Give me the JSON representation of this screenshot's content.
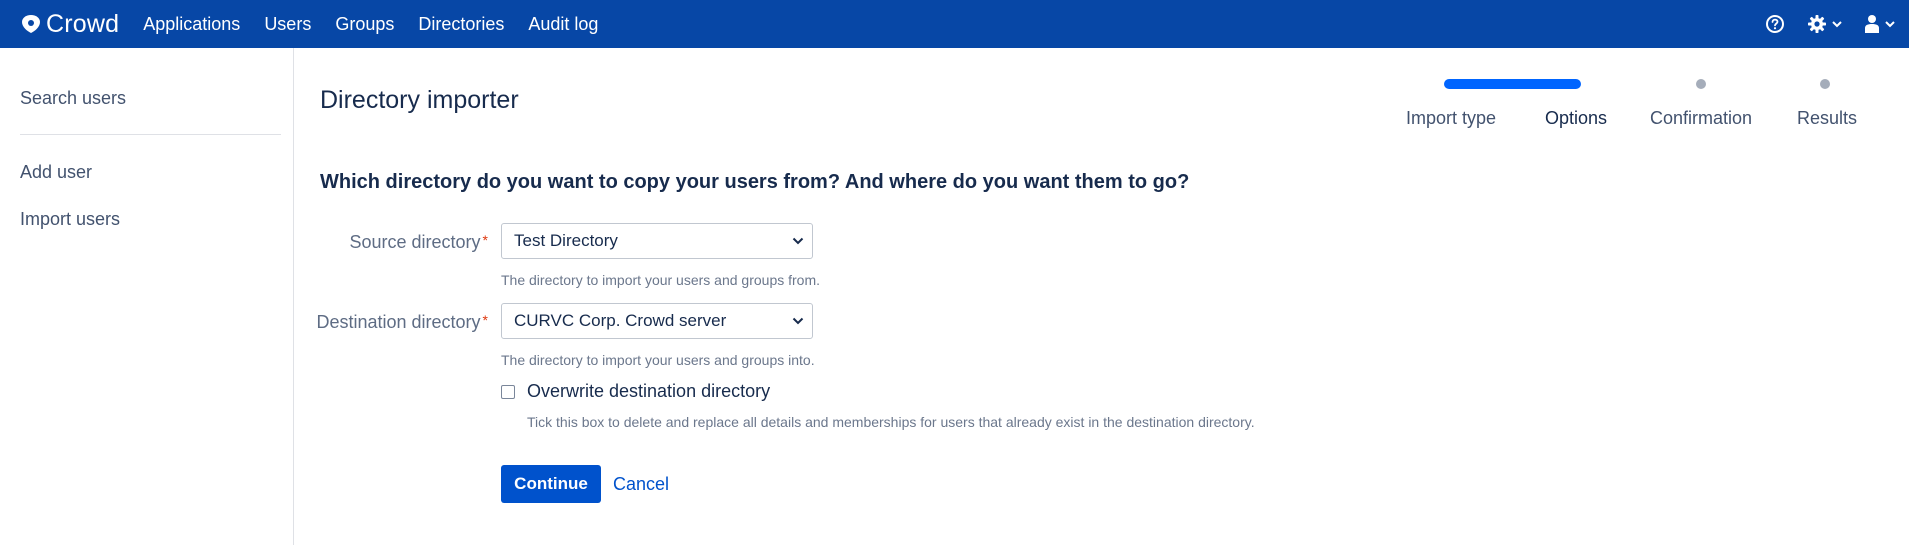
{
  "app": {
    "name": "Crowd",
    "logo_icon": "crowd-logo-icon"
  },
  "topnav": {
    "items": [
      "Applications",
      "Users",
      "Groups",
      "Directories",
      "Audit log"
    ],
    "help_icon": "help-icon",
    "settings_icon": "gear-icon",
    "user_icon": "user-icon"
  },
  "sidebar": {
    "search_users": "Search users",
    "add_user": "Add user",
    "import_users": "Import users"
  },
  "page": {
    "title": "Directory importer",
    "question": "Which directory do you want to copy your users from? And where do you want them to go?"
  },
  "steps": {
    "items": [
      "Import type",
      "Options",
      "Confirmation",
      "Results"
    ],
    "current_index": 1,
    "accent": "#0065ff",
    "inactive": "#a5adba"
  },
  "form": {
    "source": {
      "label": "Source directory",
      "value": "Test Directory",
      "help": "The directory to import your users and groups from."
    },
    "destination": {
      "label": "Destination directory",
      "value": "CURVC Corp. Crowd server",
      "help": "The directory to import your users and groups into."
    },
    "required_mark": "*",
    "overwrite": {
      "label": "Overwrite destination directory",
      "checked": false,
      "help": "Tick this box to delete and replace all details and memberships for users that already exist in the destination directory."
    }
  },
  "actions": {
    "continue": "Continue",
    "cancel": "Cancel"
  },
  "colors": {
    "header": "#0747a6",
    "primary": "#0052cc",
    "required": "#de350b"
  }
}
